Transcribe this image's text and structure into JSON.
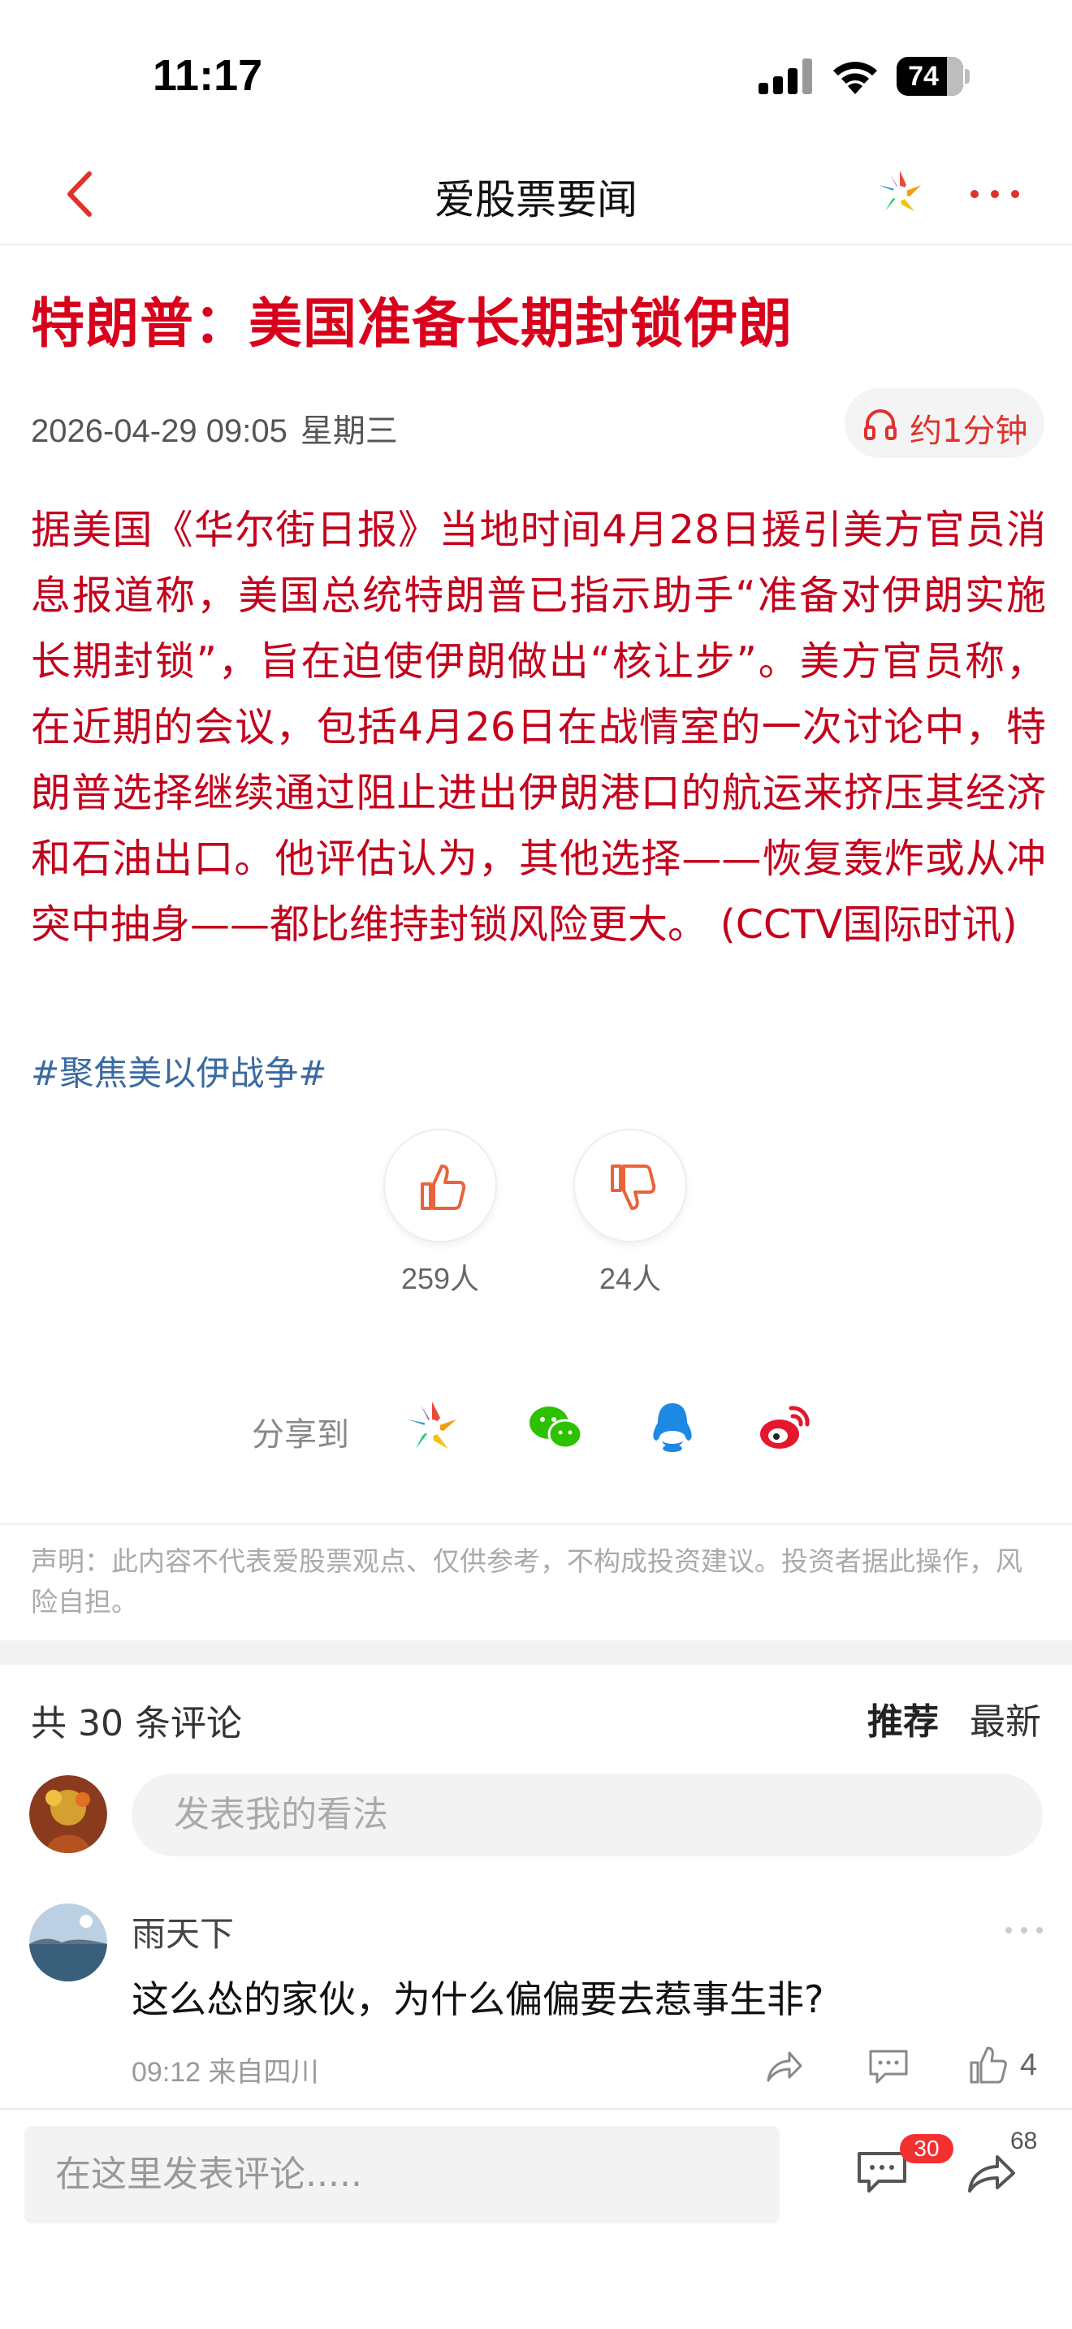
{
  "status_bar": {
    "time": "11:17",
    "battery": "74"
  },
  "nav": {
    "title": "爱股票要闻"
  },
  "article": {
    "headline": "特朗普：美国准备长期封锁伊朗",
    "date": "2026-04-29 09:05",
    "weekday": "星期三",
    "listen_label": "约1分钟",
    "body": "据美国《华尔街日报》当地时间4月28日援引美方官员消息报道称，美国总统特朗普已指示助手“准备对伊朗实施长期封锁”，旨在迫使伊朗做出“核让步”。美方官员称，在近期的会议，包括4月26日在战情室的一次讨论中，特朗普选择继续通过阻止进出伊朗港口的航运来挤压其经济和石油出口。他评估认为，其他选择——恢复轰炸或从冲突中抽身——都比维持封锁风险更大。 (CCTV国际时讯)",
    "topic": "#聚焦美以伊战争#"
  },
  "votes": {
    "up_count": "259人",
    "down_count": "24人"
  },
  "share": {
    "label": "分享到",
    "icons": [
      "ai-gupiao-icon",
      "wechat-icon",
      "qq-icon",
      "weibo-icon"
    ]
  },
  "disclaimer": "声明：此内容不代表爱股票观点、仅供参考，不构成投资建议。投资者据此操作，风险自担。",
  "comments": {
    "header": "共 30 条评论",
    "sort_recommend": "推荐",
    "sort_latest": "最新",
    "input_placeholder": "发表我的看法",
    "items": [
      {
        "user": "雨天下",
        "text": "这么怂的家伙，为什么偏偏要去惹事生非?",
        "time": "09:12 来自四川",
        "likes": "4"
      }
    ]
  },
  "bottom_bar": {
    "placeholder": "在这里发表评论.....",
    "comment_badge": "30",
    "share_count": "68"
  },
  "colors": {
    "accent_red": "#d9001b",
    "topic_blue": "#3a6aa0",
    "badge_red": "#f23030"
  }
}
